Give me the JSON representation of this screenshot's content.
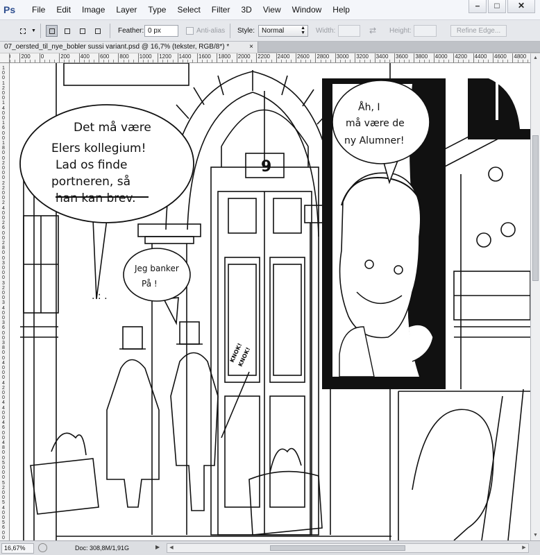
{
  "app": {
    "logo": "Ps",
    "menus": [
      "File",
      "Edit",
      "Image",
      "Layer",
      "Type",
      "Select",
      "Filter",
      "3D",
      "View",
      "Window",
      "Help"
    ],
    "window_controls": {
      "minimize": "–",
      "maximize": "□",
      "close": "✕"
    }
  },
  "options": {
    "feather_label": "Feather:",
    "feather_value": "0 px",
    "antialias_label": "Anti-alias",
    "style_label": "Style:",
    "style_value": "Normal",
    "width_label": "Width:",
    "height_label": "Height:",
    "refine_label": "Refine Edge..."
  },
  "document": {
    "tab_title": "07_oersted_til_nye_bobler sussi variant.psd @ 16,7% (tekster, RGB/8*) *",
    "tab_close": "×"
  },
  "ruler": {
    "top_labels": [
      "400",
      "200",
      "0",
      "200",
      "400",
      "600",
      "800",
      "1000",
      "1200",
      "1400",
      "1600",
      "1800",
      "2000",
      "2200",
      "2400",
      "2600",
      "2800",
      "3000",
      "3200",
      "3400",
      "3600",
      "3800",
      "4000",
      "4200",
      "4400",
      "4600",
      "4800"
    ],
    "left_labels": [
      "1",
      "0",
      "0",
      "1",
      "2",
      "0",
      "0",
      "1",
      "4",
      "0",
      "0",
      "1",
      "6",
      "0",
      "0",
      "1",
      "8",
      "0",
      "0",
      "2",
      "0",
      "0",
      "0",
      "2",
      "2",
      "0",
      "0",
      "2",
      "4",
      "0",
      "0",
      "2",
      "6",
      "0",
      "0",
      "2",
      "8",
      "0",
      "0",
      "3",
      "0",
      "0",
      "0",
      "3",
      "2",
      "0",
      "0",
      "3",
      "4",
      "0",
      "0",
      "3",
      "6",
      "0",
      "0",
      "3",
      "8",
      "0",
      "0",
      "4",
      "0",
      "0",
      "0",
      "4",
      "2",
      "0",
      "0",
      "4",
      "4",
      "0",
      "0",
      "4",
      "6",
      "0",
      "0",
      "4",
      "8",
      "0",
      "0",
      "5",
      "0",
      "0",
      "0",
      "5",
      "2",
      "0",
      "0",
      "5",
      "4",
      "0",
      "0",
      "5",
      "6",
      "0",
      "0"
    ]
  },
  "comic": {
    "bubble1": [
      "Det må være",
      "Elers kollegium!",
      "Lad os  finde",
      "portneren, så",
      "han kan  brev."
    ],
    "bubble2": [
      "Jeg banker",
      "På  !"
    ],
    "bubble3": [
      "Åh, I",
      "må være de",
      "ny Alumner!"
    ],
    "door_number": "9",
    "sfx": [
      "KNOK!",
      "KNOK!"
    ],
    "dots": ". : ."
  },
  "status": {
    "zoom": "16,67%",
    "doc": "Doc: 308,8M/1,91G",
    "arrow": "▶"
  }
}
